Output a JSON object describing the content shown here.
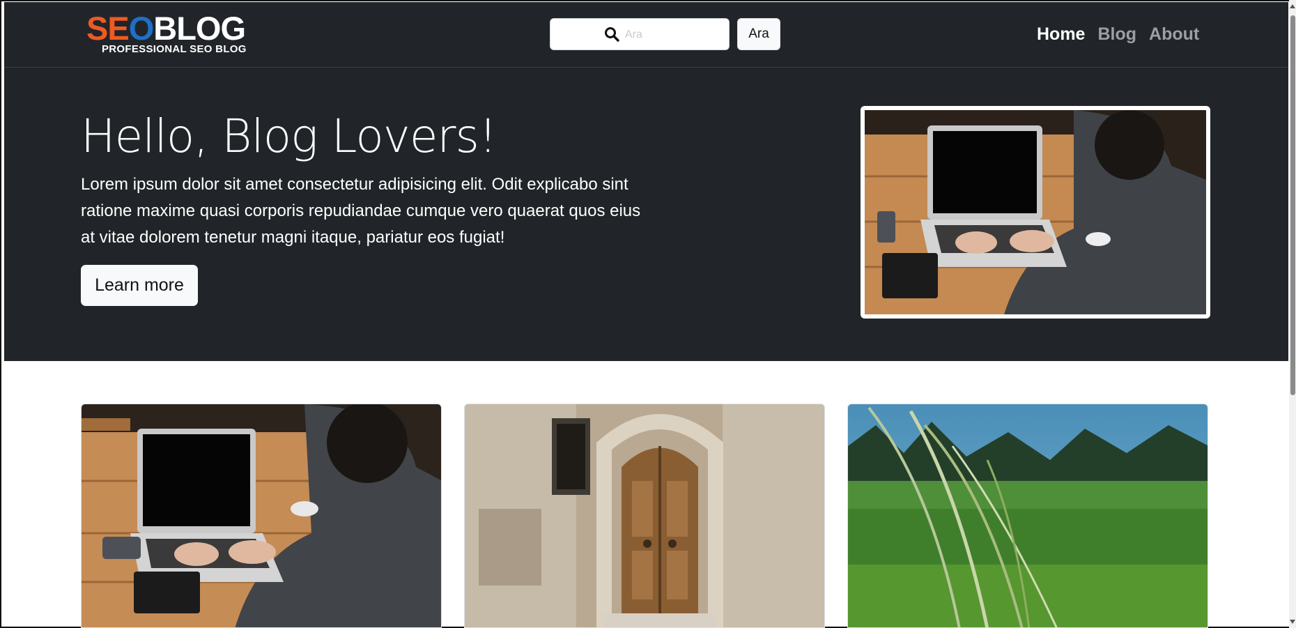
{
  "header": {
    "logo": {
      "seo_letters": [
        "S",
        "E",
        "O"
      ],
      "blog_text": "BLOG",
      "tagline": "PROFESSIONAL SEO BLOG"
    },
    "search": {
      "placeholder": "Ara",
      "value": "",
      "button_label": "Ara",
      "icon": "search-icon"
    },
    "nav": [
      {
        "label": "Home",
        "active": true
      },
      {
        "label": "Blog",
        "active": false
      },
      {
        "label": "About",
        "active": false
      }
    ]
  },
  "hero": {
    "title": "Hello, Blog Lovers!",
    "text": "Lorem ipsum dolor sit amet consectetur adipisicing elit. Odit explicabo sint ratione maxime quasi corporis repudiandae cumque vero quaerat quos eius at vitae dolorem tenetur magni itaque, pariatur eos fugiat!",
    "button_label": "Learn more",
    "image": "laptop-desk-photo"
  },
  "cards": [
    {
      "image": "laptop-desk-photo"
    },
    {
      "image": "wooden-door-photo"
    },
    {
      "image": "grass-field-photo"
    }
  ],
  "colors": {
    "navbar_bg": "#212529",
    "hero_bg": "#212529",
    "logo_orange": "#f05a22",
    "logo_blue": "#1f6fc5",
    "nav_active": "#ffffff",
    "nav_inactive": "#9ba0a5"
  }
}
